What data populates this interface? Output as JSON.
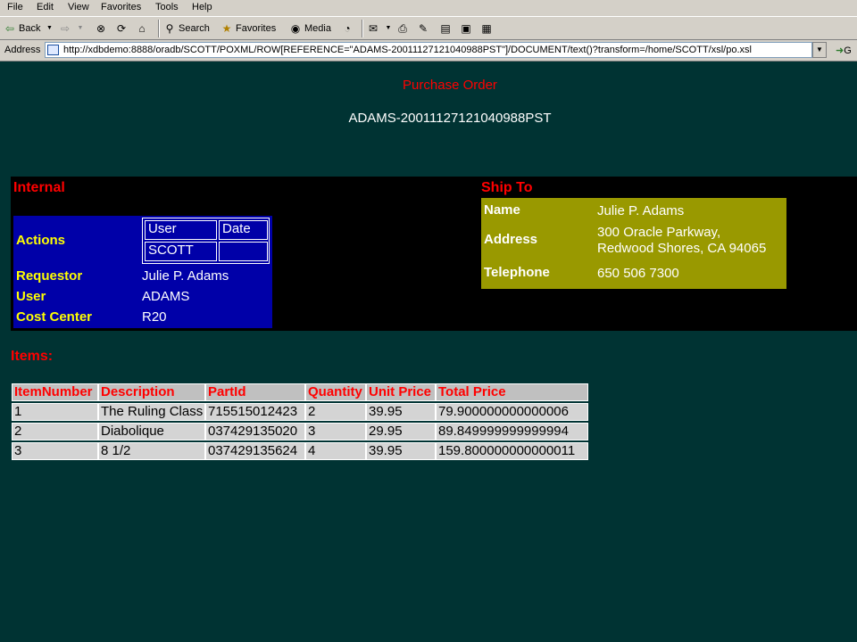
{
  "browser": {
    "menu": [
      "File",
      "Edit",
      "View",
      "Favorites",
      "Tools",
      "Help"
    ],
    "toolbar": {
      "back_label": "Back",
      "search_label": "Search",
      "favorites_label": "Favorites",
      "media_label": "Media"
    },
    "address_label": "Address",
    "url": "http://xdbdemo:8888/oradb/SCOTT/POXML/ROW[REFERENCE=\"ADAMS-20011127121040988PST\"]/DOCUMENT/text()?transform=/home/SCOTT/xsl/po.xsl",
    "go_label": "G"
  },
  "page": {
    "title": "Purchase Order",
    "reference": "ADAMS-20011127121040988PST"
  },
  "internal": {
    "heading": "Internal",
    "actions_label": "Actions",
    "actions_table": {
      "headers": [
        "User",
        "Date"
      ],
      "rows": [
        [
          "SCOTT",
          ""
        ]
      ]
    },
    "requestor_label": "Requestor",
    "requestor": "Julie P. Adams",
    "user_label": "User",
    "user": "ADAMS",
    "cost_center_label": "Cost Center",
    "cost_center": "R20"
  },
  "ship_to": {
    "heading": "Ship To",
    "name_label": "Name",
    "name": "Julie P. Adams",
    "address_label": "Address",
    "address_line1": "300 Oracle Parkway,",
    "address_line2": "Redwood Shores, CA 94065",
    "telephone_label": "Telephone",
    "telephone": "650 506 7300"
  },
  "items": {
    "heading": "Items:",
    "columns": [
      "ItemNumber",
      "Description",
      "PartId",
      "Quantity",
      "Unit Price",
      "Total Price"
    ],
    "rows": [
      [
        "1",
        "The Ruling Class",
        "715515012423",
        "2",
        "39.95",
        "79.900000000000006"
      ],
      [
        "2",
        "Diabolique",
        "037429135020",
        "3",
        "29.95",
        "89.849999999999994"
      ],
      [
        "3",
        "8 1/2",
        "037429135624",
        "4",
        "39.95",
        "159.800000000000011"
      ]
    ]
  },
  "colors": {
    "page_background": "#003333",
    "heading_red": "#ff0000",
    "internal_box": "#0000a8",
    "label_yellow": "#ffff00",
    "ship_to_box": "#999900"
  }
}
